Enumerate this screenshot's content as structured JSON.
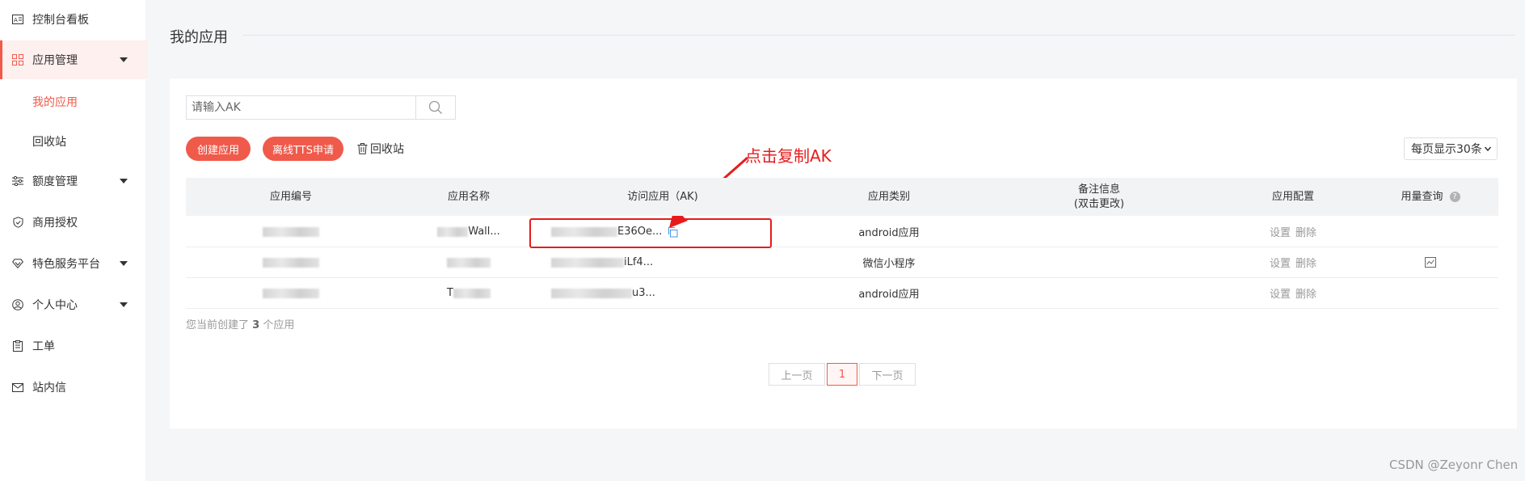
{
  "sidebar": {
    "items": [
      {
        "label": "控制台看板",
        "icon": "dashboard-icon"
      },
      {
        "label": "应用管理",
        "icon": "grid-icon",
        "expanded": true
      },
      {
        "label": "额度管理",
        "icon": "sliders-icon"
      },
      {
        "label": "商用授权",
        "icon": "shield-icon"
      },
      {
        "label": "特色服务平台",
        "icon": "diamond-icon"
      },
      {
        "label": "个人中心",
        "icon": "user-icon"
      },
      {
        "label": "工单",
        "icon": "clipboard-icon"
      },
      {
        "label": "站内信",
        "icon": "mail-icon"
      }
    ],
    "subitems": [
      {
        "label": "我的应用",
        "current": true
      },
      {
        "label": "回收站"
      }
    ]
  },
  "page": {
    "title": "我的应用"
  },
  "search": {
    "placeholder": "请输入AK"
  },
  "actions": {
    "create": "创建应用",
    "offline_tts": "离线TTS申请",
    "recycle": "回收站",
    "per_page": "每页显示30条"
  },
  "table": {
    "headers": [
      "应用编号",
      "应用名称",
      "访问应用（AK)",
      "应用类别",
      "备注信息\n(双击更改)",
      "应用配置",
      "用量查询"
    ],
    "rows": [
      {
        "name": "Wall...",
        "ak": "E36Oe...",
        "type": "android应用",
        "ops": [
          "设置",
          "删除"
        ],
        "has_chart": false
      },
      {
        "name": "",
        "ak": "iLf4...",
        "type": "微信小程序",
        "ops": [
          "设置",
          "删除"
        ],
        "has_chart": true
      },
      {
        "name": "T",
        "ak": "u3...",
        "type": "android应用",
        "ops": [
          "设置",
          "删除"
        ],
        "has_chart": false
      }
    ]
  },
  "summary": {
    "prefix": "您当前创建了",
    "count": "3",
    "suffix": "个应用"
  },
  "pagination": {
    "prev": "上一页",
    "current": "1",
    "next": "下一页"
  },
  "annotation": {
    "text": "点击复制AK",
    "color": "#e61c1c"
  },
  "watermark": "CSDN @Zeyonr Chen",
  "colors": {
    "accent": "#f05a4b",
    "annotation": "#e61c1c"
  }
}
